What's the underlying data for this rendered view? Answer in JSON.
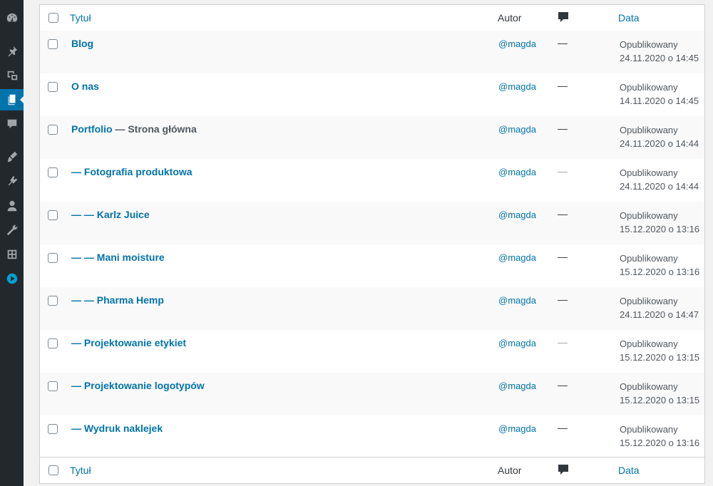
{
  "sidebar": {
    "items": [
      {
        "icon": "dashboard-icon"
      },
      {
        "icon": "pin-icon"
      },
      {
        "icon": "media-icon"
      },
      {
        "icon": "pages-icon",
        "active": true
      },
      {
        "icon": "comment-icon"
      },
      {
        "icon": "appearance-icon"
      },
      {
        "icon": "plugins-icon"
      },
      {
        "icon": "users-icon"
      },
      {
        "icon": "tools-icon"
      },
      {
        "icon": "settings-icon"
      },
      {
        "icon": "play-circle-icon"
      }
    ]
  },
  "table": {
    "headers": {
      "title": "Tytuł",
      "author": "Autor",
      "date": "Data"
    },
    "rows": [
      {
        "title": "Blog",
        "suffix": "",
        "author": "@magda",
        "comments": "—",
        "status": "Opublikowany",
        "date": "24.11.2020 o 14:45"
      },
      {
        "title": "O nas",
        "suffix": "",
        "author": "@magda",
        "comments": "—",
        "status": "Opublikowany",
        "date": "14.11.2020 o 14:45"
      },
      {
        "title": "Portfolio",
        "suffix": " — Strona główna",
        "author": "@magda",
        "comments": "—",
        "status": "Opublikowany",
        "date": "24.11.2020 o 14:44"
      },
      {
        "title": "— Fotografia produktowa",
        "suffix": "",
        "author": "@magda",
        "comments": "—",
        "status": "Opublikowany",
        "date": "24.11.2020 o 14:44"
      },
      {
        "title": "— — Karlz Juice",
        "suffix": "",
        "author": "@magda",
        "comments": "—",
        "status": "Opublikowany",
        "date": "15.12.2020 o 13:16"
      },
      {
        "title": "— — Mani moisture",
        "suffix": "",
        "author": "@magda",
        "comments": "—",
        "status": "Opublikowany",
        "date": "15.12.2020 o 13:16"
      },
      {
        "title": "— — Pharma Hemp",
        "suffix": "",
        "author": "@magda",
        "comments": "—",
        "status": "Opublikowany",
        "date": "24.11.2020 o 14:47"
      },
      {
        "title": "— Projektowanie etykiet",
        "suffix": "",
        "author": "@magda",
        "comments": "—",
        "status": "Opublikowany",
        "date": "15.12.2020 o 13:15"
      },
      {
        "title": "— Projektowanie logotypów",
        "suffix": "",
        "author": "@magda",
        "comments": "—",
        "status": "Opublikowany",
        "date": "15.12.2020 o 13:15"
      },
      {
        "title": "— Wydruk naklejek",
        "suffix": "",
        "author": "@magda",
        "comments": "—",
        "status": "Opublikowany",
        "date": "15.12.2020 o 13:16"
      }
    ]
  },
  "colors": {
    "link": "#0073aa",
    "sidebar": "#23282d",
    "active": "#0073aa"
  }
}
